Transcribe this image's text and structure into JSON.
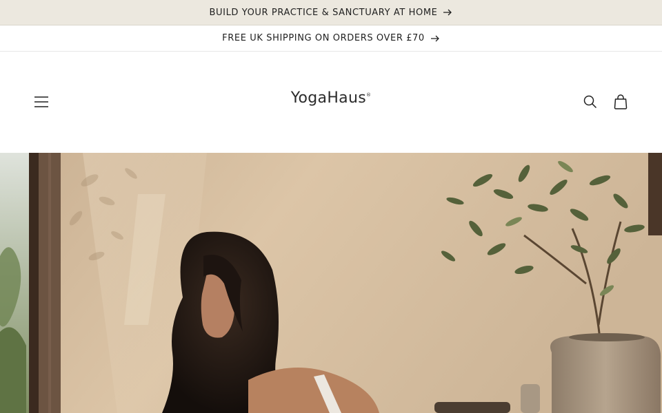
{
  "announcements": [
    {
      "text": "BUILD YOUR PRACTICE & SANCTUARY AT HOME",
      "icon": "arrow-right-icon"
    },
    {
      "text": "FREE UK SHIPPING ON ORDERS OVER £70",
      "icon": "arrow-right-icon"
    }
  ],
  "header": {
    "logo_text": "YogaHaus",
    "logo_mark": "®",
    "menu_icon": "hamburger-menu-icon",
    "search_icon": "search-icon",
    "cart_icon": "cart-icon"
  },
  "hero": {
    "image": "woman-with-long-dark-hair-in-sunlit-room-with-potted-olive-tree"
  },
  "colors": {
    "announcement_bg": "#ece8df",
    "text": "#1f1f1f",
    "wall": "#d8c2a4"
  }
}
